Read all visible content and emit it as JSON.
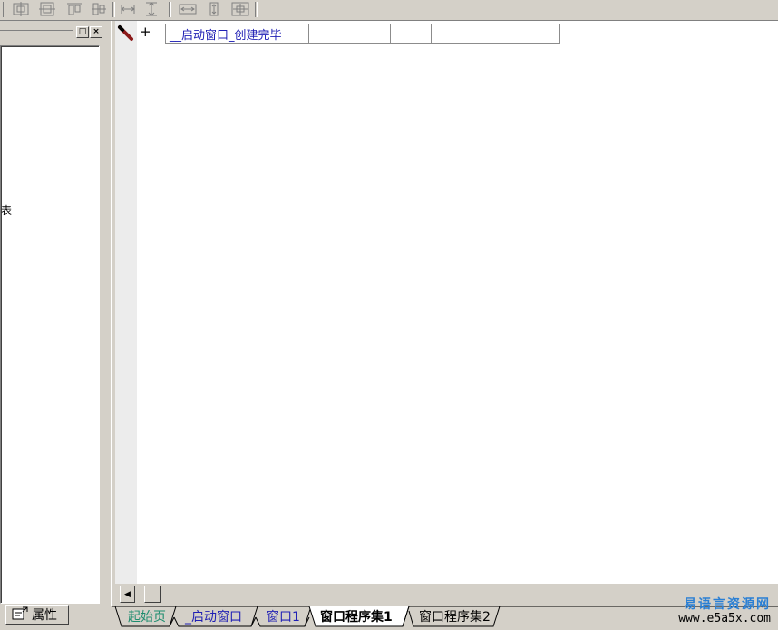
{
  "toolbar": {
    "buttons": [
      {
        "name": "center-horizontal-icon"
      },
      {
        "name": "center-vertical-icon"
      },
      {
        "name": "align-top-icon"
      },
      {
        "name": "align-middle-icon"
      },
      {
        "name": "same-width-icon"
      },
      {
        "name": "same-height-icon"
      },
      {
        "name": "space-horizontal-icon"
      },
      {
        "name": "space-vertical-icon"
      },
      {
        "name": "center-form-icon"
      }
    ]
  },
  "left_panel": {
    "restore_label": "□",
    "close_label": "×",
    "fragment_text": "表",
    "tab_label": "属性"
  },
  "editor": {
    "expand_label": "+",
    "sub_name": "__启动窗口_创建完毕",
    "cells": [
      "",
      "",
      "",
      ""
    ]
  },
  "tabs": [
    {
      "label": "起始页",
      "color": "#1c8c6e",
      "active": false
    },
    {
      "label": "_启动窗口",
      "color": "#1f1fb4",
      "active": false
    },
    {
      "label": "窗口1",
      "color": "#1f1fb4",
      "active": false
    },
    {
      "label": "窗口程序集1",
      "color": "#000000",
      "active": true
    },
    {
      "label": "窗口程序集2",
      "color": "#000000",
      "active": false
    }
  ],
  "watermark": {
    "title": "易语言资源网",
    "url": "www.e5a5x.com"
  }
}
